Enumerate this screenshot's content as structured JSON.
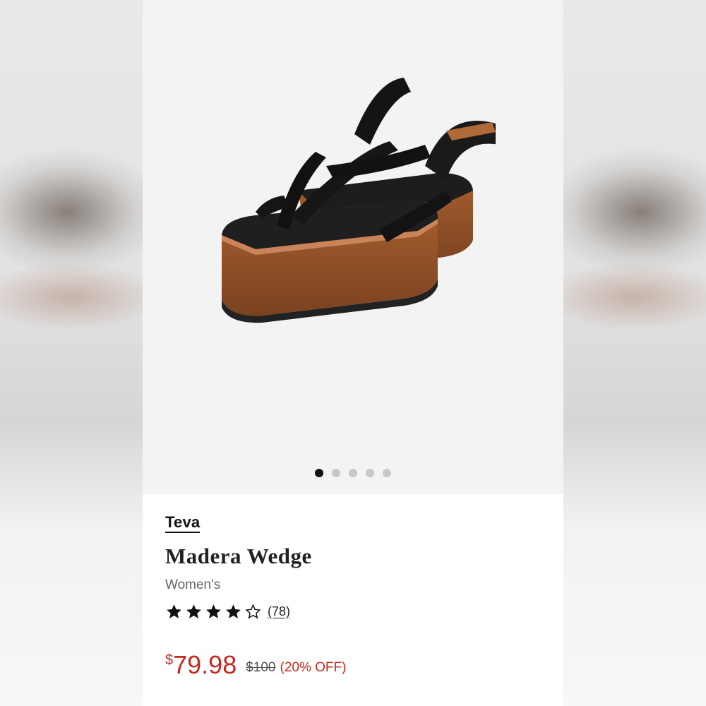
{
  "product": {
    "brand": "Teva",
    "name": "Madera Wedge",
    "gender": "Women's",
    "rating": 4,
    "rating_max": 5,
    "review_count": "(78)",
    "price_currency": "$",
    "price_value": "79.98",
    "original_price": "$100",
    "discount": "(20% OFF)",
    "image_icon": "sandal-image"
  },
  "carousel": {
    "total": 5,
    "active_index": 0
  },
  "colors": {
    "sale_red": "#c8291e",
    "text_dark": "#111111",
    "text_muted": "#666666",
    "image_bg": "#f3f3f3"
  }
}
